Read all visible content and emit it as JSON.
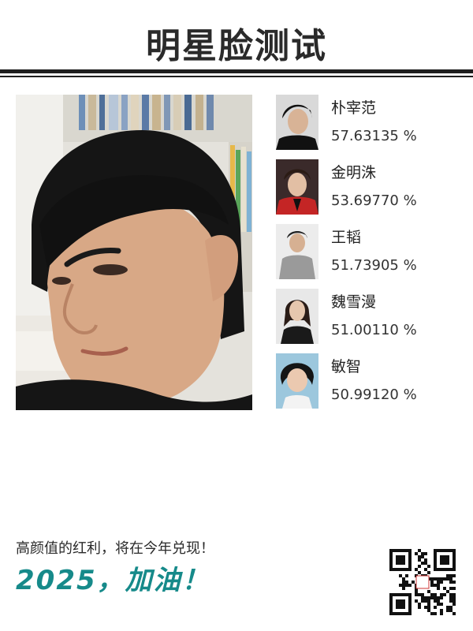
{
  "header": {
    "title": "明星脸测试"
  },
  "matches": [
    {
      "name": "朴宰范",
      "score": "57.63135 %"
    },
    {
      "name": "金明洙",
      "score": "53.69770 %"
    },
    {
      "name": "王韬",
      "score": "51.73905 %"
    },
    {
      "name": "魏雪漫",
      "score": "51.00110 %"
    },
    {
      "name": "敏智",
      "score": "50.99120 %"
    }
  ],
  "footer": {
    "slogan": "高颜值的红利，将在今年兑现！",
    "cheer": "2025，加油！"
  },
  "colors": {
    "accent": "#168a8a",
    "rule": "#1e1e1e"
  }
}
